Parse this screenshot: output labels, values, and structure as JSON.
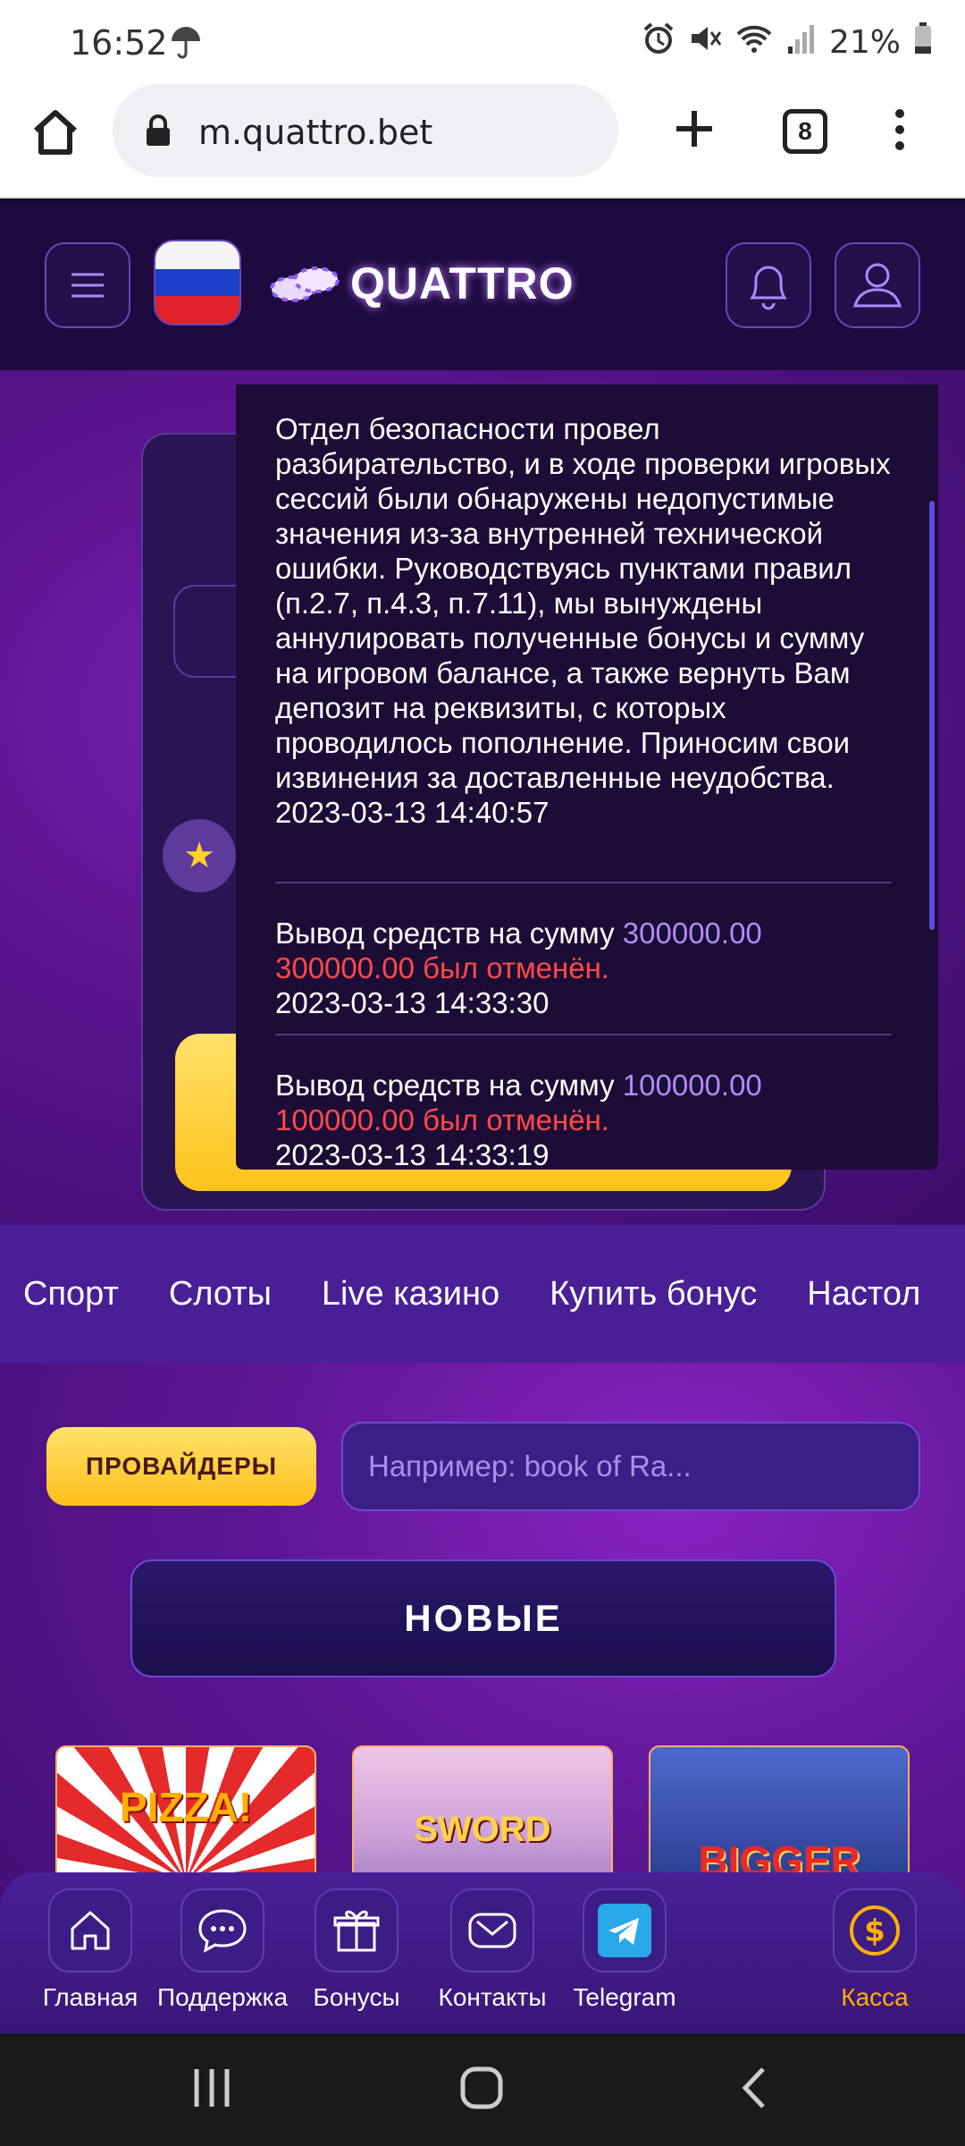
{
  "status_bar": {
    "time": "16:52",
    "battery": "21%",
    "icons": [
      "umbrella-icon",
      "alarm-icon",
      "mute-icon",
      "wifi-icon",
      "signal-icon",
      "battery-icon"
    ]
  },
  "browser": {
    "url": "m.quattro.bet",
    "tab_count": "8"
  },
  "header": {
    "logo_text": "QUATTRO",
    "flag": "ru"
  },
  "notifications": [
    {
      "text": "Отдел безопасности провел разбирательство, и в ходе проверки игровых сессий были обнаружены недопустимые значения из-за внутренней технической ошибки. Руководствуясь пунктами правил (п.2.7, п.4.3, п.7.11), мы вынуждены аннулировать полученные бонусы и сумму на игровом балансе, а также вернуть Вам депозит на реквизиты, с которых проводилось пополнение. Приносим свои извинения за доставленные неудобства.",
      "timestamp": "2023-03-13 14:40:57"
    },
    {
      "prefix": "Вывод средств на сумму",
      "amount": "300000.00",
      "status": "300000.00 был отменён.",
      "timestamp": "2023-03-13 14:33:30"
    },
    {
      "prefix": "Вывод средств на сумму",
      "amount": "100000.00",
      "status": "100000.00 был отменён.",
      "timestamp": "2023-03-13 14:33:19"
    }
  ],
  "categories": [
    "Спорт",
    "Слоты",
    "Live казино",
    "Купить бонус",
    "Настол"
  ],
  "providers_button": "ПРОВАЙДЕРЫ",
  "search": {
    "placeholder": "Например: book of Ra..."
  },
  "section_title": "НОВЫЕ",
  "games": [
    {
      "title": "PIZZA!"
    },
    {
      "title": "SWORD"
    },
    {
      "title": "BIGGER"
    }
  ],
  "bottom_nav": [
    {
      "label": "Главная",
      "icon": "home-icon"
    },
    {
      "label": "Поддержка",
      "icon": "chat-icon"
    },
    {
      "label": "Бонусы",
      "icon": "gift-icon"
    },
    {
      "label": "Контакты",
      "icon": "mail-icon"
    },
    {
      "label": "Telegram",
      "icon": "telegram-icon"
    },
    {
      "label": "Касса",
      "icon": "dollar-icon"
    }
  ],
  "colors": {
    "accent_yellow": "#ffc21a",
    "amount_purple": "#b08cff",
    "cancel_red": "#ff4a4a",
    "header_bg": "#1f0a40",
    "kassa_label": "#ffb000"
  }
}
